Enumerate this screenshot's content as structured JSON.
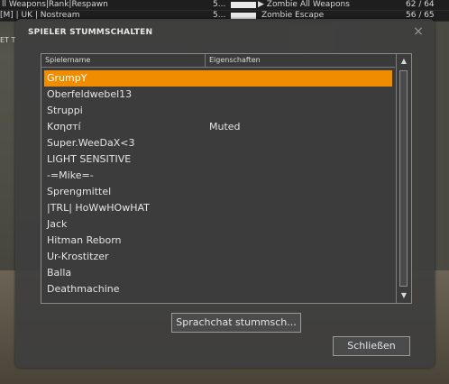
{
  "background": {
    "rows": [
      {
        "left": "ll Weapons|Rank|Respawn",
        "count": "5...",
        "map": "▶ Zombie All Weapons",
        "players": "62 / 64"
      },
      {
        "left": "[M] | UK | Nostream",
        "count": "5...",
        "map": "Zombie Escape",
        "players": "56 / 65"
      }
    ],
    "side_text": "ET T"
  },
  "dialog": {
    "title": "SPIELER STUMMSCHALTEN",
    "close_icon": "×"
  },
  "list": {
    "columns": [
      "Spielername",
      "Eigenschaften"
    ],
    "selected_color": "#f08c00",
    "players": [
      {
        "name": "GrumpY",
        "props": "",
        "selected": true
      },
      {
        "name": "Oberfeldwebel13",
        "props": ""
      },
      {
        "name": "Struppi",
        "props": ""
      },
      {
        "name": "Kσησтí",
        "props": "Muted"
      },
      {
        "name": "Super.WeeDaX<3",
        "props": ""
      },
      {
        "name": "LIGHT SENSITIVE",
        "props": ""
      },
      {
        "name": "-=Mike=-",
        "props": ""
      },
      {
        "name": "Sprengmittel",
        "props": ""
      },
      {
        "name": "|TRL| HoWwHOwHAT",
        "props": ""
      },
      {
        "name": "Jack",
        "props": ""
      },
      {
        "name": "Hitman Reborn",
        "props": ""
      },
      {
        "name": "Ur-Krostitzer",
        "props": ""
      },
      {
        "name": "Balla",
        "props": ""
      },
      {
        "name": "Deathmachine",
        "props": ""
      }
    ],
    "scroll_up": "▲",
    "scroll_down": "▼"
  },
  "buttons": {
    "mute": "Sprachchat stummsch...",
    "close": "Schließen"
  }
}
